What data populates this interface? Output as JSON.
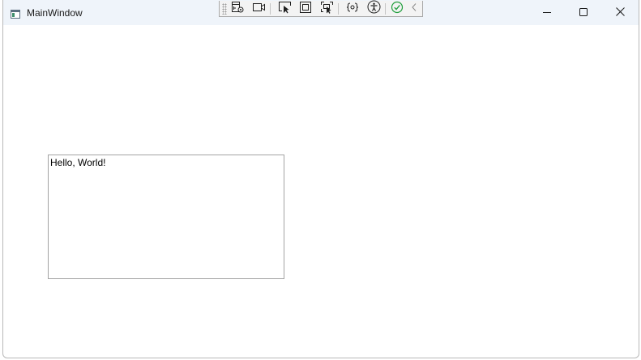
{
  "window": {
    "title": "MainWindow"
  },
  "icons": {
    "app": "app-window-icon",
    "minimize": "minimize-icon",
    "maximize": "maximize-icon",
    "close": "close-icon",
    "toolbar": [
      "live-visual-tree-icon",
      "record-video-icon",
      "select-element-icon",
      "display-layout-adorners-icon",
      "track-focus-icon",
      "binding-failures-icon",
      "accessibility-icon",
      "xaml-hot-reload-check-icon",
      "collapse-chevron-icon"
    ]
  },
  "textbox": {
    "value": "Hello, World!"
  }
}
